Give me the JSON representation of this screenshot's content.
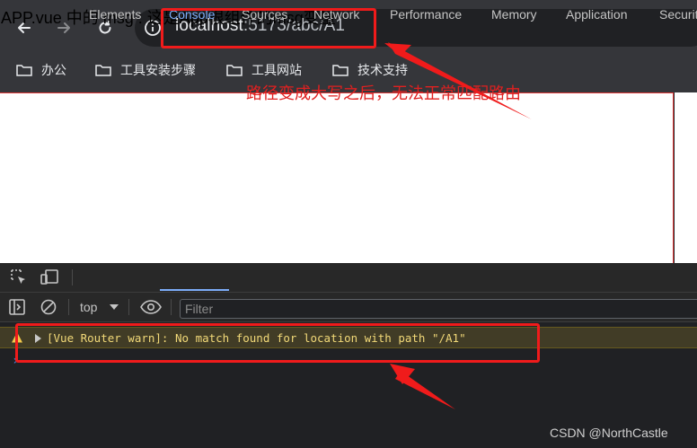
{
  "browser": {
    "url_host": "localhost",
    "url_port_path": ":5173/abc/A1",
    "bookmarks": [
      "办公",
      "工具安装步骤",
      "工具网站",
      "技术支持"
    ]
  },
  "page": {
    "message": "APP.vue 中的 msg : 这是App根组件的msg变量",
    "annotation": "路径变成大写之后，无法正常匹配路由"
  },
  "devtools": {
    "tabs": [
      "Elements",
      "Console",
      "Sources",
      "Network",
      "Performance",
      "Memory",
      "Application",
      "Securit"
    ],
    "active_tab": "Console",
    "context_selector": "top",
    "filter_placeholder": "Filter",
    "warning_message": "[Vue Router warn]: No match found for location with path \"/A1\"",
    "prompt_symbol": "›"
  },
  "watermark": "CSDN @NorthCastle",
  "colors": {
    "highlight_red": "#f01b1b",
    "active_tab_blue": "#7cacf8",
    "warning_text": "#f2d978",
    "warning_bg": "#413c26"
  }
}
